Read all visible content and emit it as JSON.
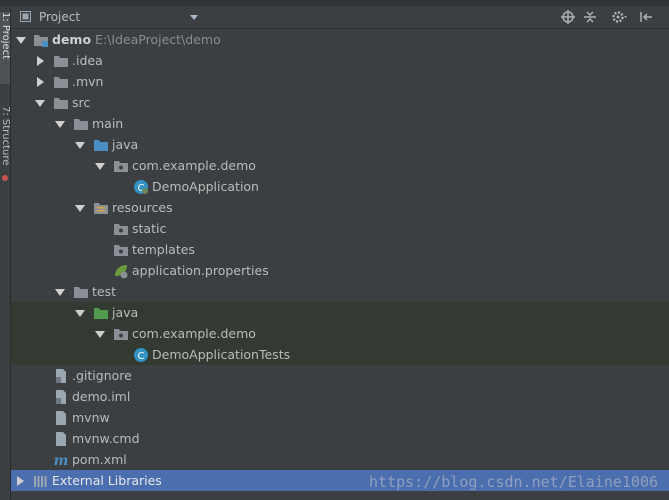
{
  "sidebar": {
    "project_tab": "1: Project",
    "structure_tab": "7: Structure"
  },
  "panel": {
    "title": "Project",
    "tools": [
      "target-icon",
      "collapse-icon",
      "gear-icon",
      "hide-icon"
    ]
  },
  "tree": [
    {
      "label": "demo",
      "path": "E:\\IdeaProject\\demo",
      "icon": "module-folder-icon"
    },
    {
      "label": ".idea",
      "icon": "folder-icon"
    },
    {
      "label": ".mvn",
      "icon": "folder-icon"
    },
    {
      "label": "src",
      "icon": "folder-icon"
    },
    {
      "label": "main",
      "icon": "folder-icon"
    },
    {
      "label": "java",
      "icon": "source-folder-icon"
    },
    {
      "label": "com.example.demo",
      "icon": "package-icon"
    },
    {
      "label": "DemoApplication",
      "icon": "spring-class-icon"
    },
    {
      "label": "resources",
      "icon": "resources-folder-icon"
    },
    {
      "label": "static",
      "icon": "package-icon"
    },
    {
      "label": "templates",
      "icon": "package-icon"
    },
    {
      "label": "application.properties",
      "icon": "spring-properties-icon"
    },
    {
      "label": "test",
      "icon": "folder-icon"
    },
    {
      "label": "java",
      "icon": "test-folder-icon"
    },
    {
      "label": "com.example.demo",
      "icon": "package-icon"
    },
    {
      "label": "DemoApplicationTests",
      "icon": "class-icon"
    },
    {
      "label": ".gitignore",
      "icon": "file-icon"
    },
    {
      "label": "demo.iml",
      "icon": "file-icon"
    },
    {
      "label": "mvnw",
      "icon": "file-icon"
    },
    {
      "label": "mvnw.cmd",
      "icon": "file-icon"
    },
    {
      "label": "pom.xml",
      "icon": "maven-icon"
    },
    {
      "label": "External Libraries",
      "icon": "libraries-icon"
    }
  ],
  "watermark": "https://blog.csdn.net/Elaine1006",
  "colors": {
    "background": "#3c3f41",
    "selection": "#4b6eaf",
    "test_highlight": "#323a32",
    "folder": "#8a9096",
    "source_folder": "#4b8ec4",
    "test_folder": "#4f9a4f"
  }
}
